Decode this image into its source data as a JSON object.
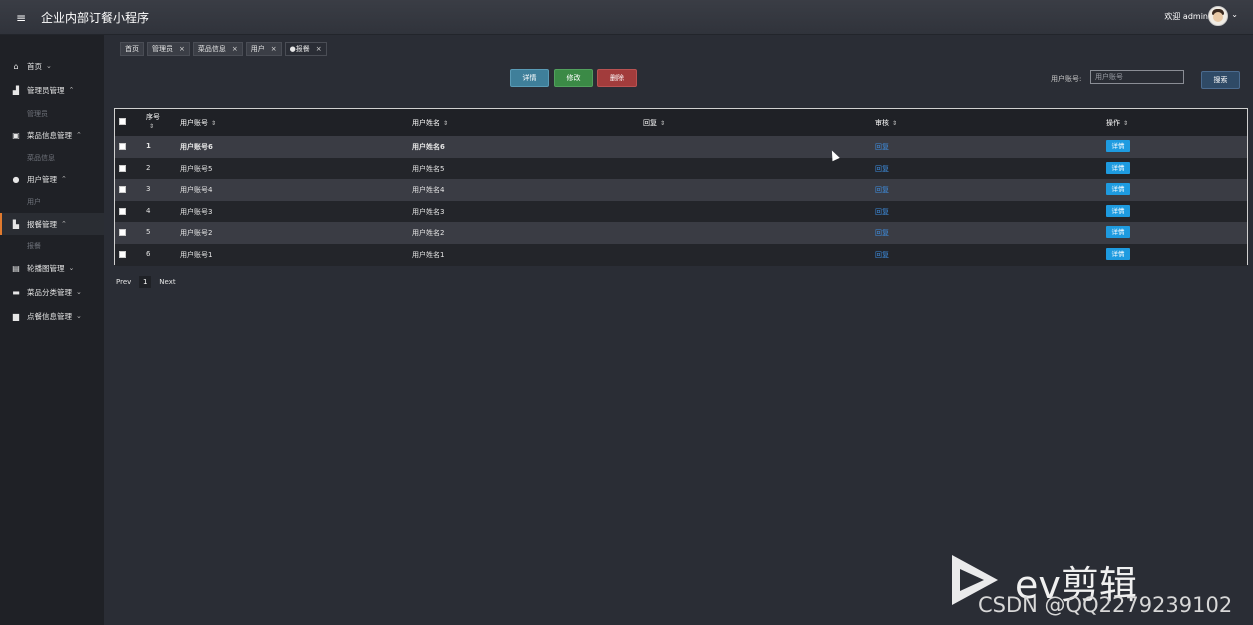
{
  "header": {
    "menu_icon": "hamburger-icon",
    "title": "企业内部订餐小程序",
    "welcome": "欢迎 admin"
  },
  "sidebar": {
    "items": [
      {
        "label": "首页",
        "icon": "home-icon",
        "caret": "⌄"
      },
      {
        "label": "管理员管理",
        "icon": "admin-icon",
        "caret": "⌃",
        "sub": "管理员"
      },
      {
        "label": "菜品信息管理",
        "icon": "book-icon",
        "caret": "⌃",
        "sub": "菜品信息"
      },
      {
        "label": "用户管理",
        "icon": "user-icon",
        "caret": "⌃",
        "sub": "用户"
      },
      {
        "label": "报餐管理",
        "icon": "store-icon",
        "caret": "⌃",
        "sub": "报餐"
      },
      {
        "label": "轮播图管理",
        "icon": "image-icon",
        "caret": "⌄"
      },
      {
        "label": "菜品分类管理",
        "icon": "category-icon",
        "caret": "⌄"
      },
      {
        "label": "点餐信息管理",
        "icon": "order-icon",
        "caret": "⌄"
      }
    ]
  },
  "tabs": [
    {
      "label": "首页",
      "closable": false
    },
    {
      "label": "管理员",
      "closable": true
    },
    {
      "label": "菜品信息",
      "closable": true
    },
    {
      "label": "用户",
      "closable": true
    },
    {
      "label": "●报餐",
      "closable": true
    }
  ],
  "toolbar": {
    "detail": "详情",
    "edit": "修改",
    "delete": "删除",
    "search_label": "用户账号:",
    "search_placeholder": "用户账号",
    "search_button": "搜索"
  },
  "table": {
    "headers": [
      "序号",
      "用户账号",
      "用户姓名",
      "回复",
      "审核",
      "操作"
    ],
    "rows": [
      {
        "no": "1",
        "account": "用户账号6",
        "name": "用户姓名6",
        "reply": "",
        "review": "回复",
        "action": "详情"
      },
      {
        "no": "2",
        "account": "用户账号5",
        "name": "用户姓名5",
        "reply": "",
        "review": "回复",
        "action": "详情"
      },
      {
        "no": "3",
        "account": "用户账号4",
        "name": "用户姓名4",
        "reply": "",
        "review": "回复",
        "action": "详情"
      },
      {
        "no": "4",
        "account": "用户账号3",
        "name": "用户姓名3",
        "reply": "",
        "review": "回复",
        "action": "详情"
      },
      {
        "no": "5",
        "account": "用户账号2",
        "name": "用户姓名2",
        "reply": "",
        "review": "回复",
        "action": "详情"
      },
      {
        "no": "6",
        "account": "用户账号1",
        "name": "用户姓名1",
        "reply": "",
        "review": "回复",
        "action": "详情"
      }
    ]
  },
  "pager": {
    "prev": "Prev",
    "current": "1",
    "next": "Next"
  },
  "watermark": {
    "brand": "ev剪辑",
    "csdn": "CSDN @QQ2279239102"
  },
  "colors": {
    "accent": "#e07a2e",
    "link": "#3e8ee0",
    "row_button": "#1e9be0"
  }
}
